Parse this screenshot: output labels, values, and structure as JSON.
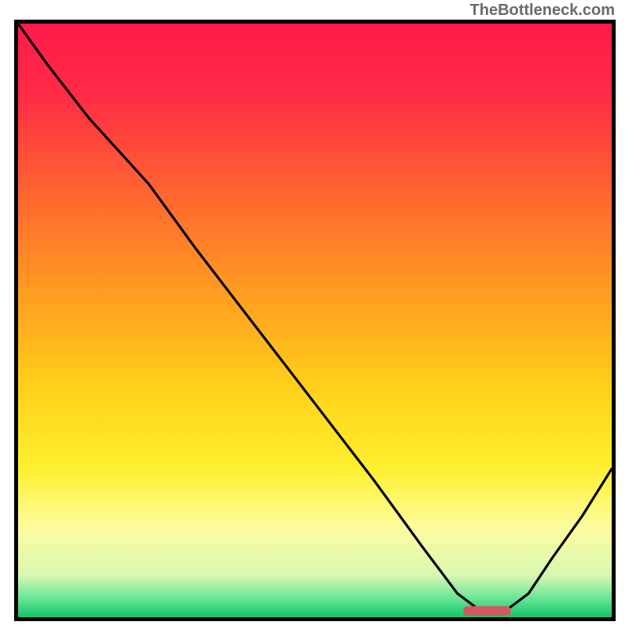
{
  "watermark": "TheBottleneck.com",
  "chart_data": {
    "type": "line",
    "title": "",
    "xlabel": "",
    "ylabel": "",
    "xlim": [
      0,
      100
    ],
    "ylim": [
      0,
      100
    ],
    "gradient_stops": [
      {
        "offset": 0.0,
        "color": "#ff1a4b"
      },
      {
        "offset": 0.12,
        "color": "#ff2b45"
      },
      {
        "offset": 0.3,
        "color": "#ff6a2f"
      },
      {
        "offset": 0.48,
        "color": "#ffa51f"
      },
      {
        "offset": 0.62,
        "color": "#ffd21a"
      },
      {
        "offset": 0.75,
        "color": "#fff030"
      },
      {
        "offset": 0.85,
        "color": "#fdfda0"
      },
      {
        "offset": 0.93,
        "color": "#d8f7b0"
      },
      {
        "offset": 0.965,
        "color": "#70e89a"
      },
      {
        "offset": 1.0,
        "color": "#13c46b"
      }
    ],
    "series": [
      {
        "name": "bottleneck-curve",
        "x": [
          0,
          5,
          12,
          22,
          30,
          40,
          50,
          60,
          68,
          74,
          78,
          82,
          86,
          90,
          95,
          100
        ],
        "y": [
          100,
          93,
          84,
          73,
          62,
          49,
          36,
          23,
          12,
          4,
          1,
          1,
          4,
          10,
          17,
          25
        ]
      }
    ],
    "marker": {
      "name": "optimum-range",
      "x": 79,
      "y": 0,
      "width": 8,
      "height": 1.6,
      "color": "#cf5b62"
    }
  }
}
